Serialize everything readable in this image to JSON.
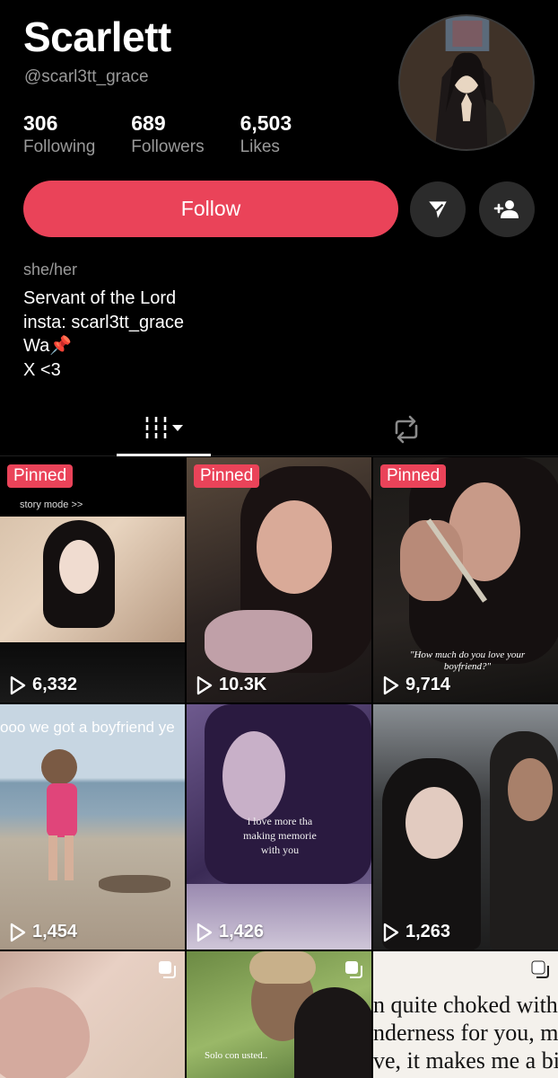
{
  "profile": {
    "display_name": "Scarlett",
    "handle": "@scarl3tt_grace",
    "stats": [
      {
        "value": "306",
        "label": "Following"
      },
      {
        "value": "689",
        "label": "Followers"
      },
      {
        "value": "6,503",
        "label": "Likes"
      }
    ],
    "follow_label": "Follow",
    "pronouns": "she/her",
    "bio_lines": [
      "Servant of the Lord",
      "insta: scarl3tt_grace",
      "Wa📌",
      "X <3"
    ]
  },
  "colors": {
    "accent": "#ea4359",
    "secondary_button": "#2b2b2b",
    "muted_text": "#9a9a9a"
  },
  "icons": {
    "message": "send-arrow-icon",
    "add_friend": "add-user-icon",
    "videos_tab": "grid-lines-icon",
    "reposts_tab": "repost-icon",
    "views": "play-icon"
  },
  "videos": [
    {
      "pinned_label": "Pinned",
      "views": "6,332",
      "overlay_text": "story mode >>"
    },
    {
      "pinned_label": "Pinned",
      "views": "10.3K"
    },
    {
      "pinned_label": "Pinned",
      "views": "9,714",
      "overlay_text": "\"How much do you love your boyfriend?\""
    },
    {
      "views": "1,454",
      "overlay_text": "ooo we got a boyfriend ye"
    },
    {
      "views": "1,426",
      "overlay_text": "i love more tha making memorie with you"
    },
    {
      "views": "1,263"
    },
    {},
    {
      "overlay_text": "Solo con usted.."
    },
    {
      "overlay_text": "n quite choked with nderness for you, my ve, it makes me a bit"
    }
  ]
}
